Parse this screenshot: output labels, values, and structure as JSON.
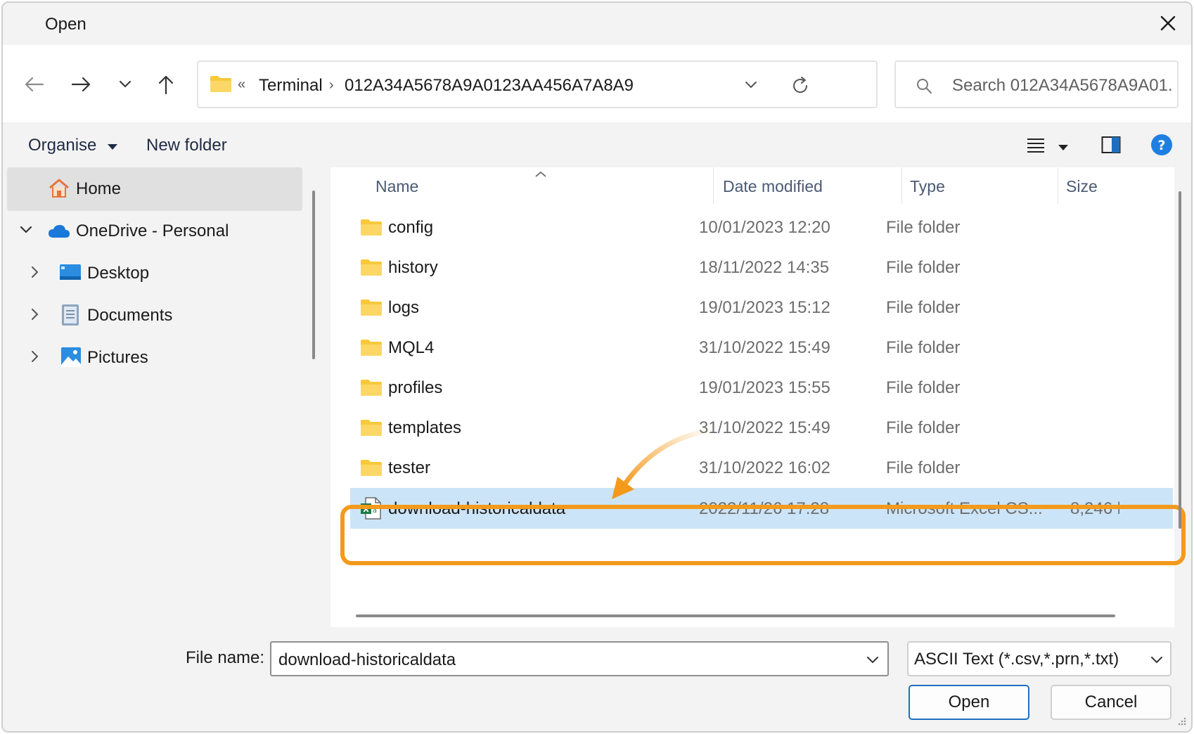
{
  "window": {
    "title": "Open"
  },
  "navigation": {
    "address_prefix": "«",
    "path": [
      "Terminal",
      "012A34A5678A9A0123AA456A7A8A9"
    ],
    "search_placeholder": "Search 012A34A5678A9A01..."
  },
  "toolbar": {
    "organise_label": "Organise",
    "new_folder_label": "New folder"
  },
  "sidebar": {
    "items": [
      {
        "label": "Home",
        "icon": "home-icon"
      },
      {
        "label": "OneDrive - Personal",
        "icon": "cloud-icon"
      },
      {
        "label": "Desktop",
        "icon": "desktop-icon"
      },
      {
        "label": "Documents",
        "icon": "documents-icon"
      },
      {
        "label": "Pictures",
        "icon": "pictures-icon"
      }
    ]
  },
  "files": {
    "columns": [
      "Name",
      "Date modified",
      "Type",
      "Size"
    ],
    "rows": [
      {
        "name": "config",
        "date": "10/01/2023 12:20",
        "type": "File folder",
        "size": ""
      },
      {
        "name": "history",
        "date": "18/11/2022 14:35",
        "type": "File folder",
        "size": ""
      },
      {
        "name": "logs",
        "date": "19/01/2023 15:12",
        "type": "File folder",
        "size": ""
      },
      {
        "name": "MQL4",
        "date": "31/10/2022 15:49",
        "type": "File folder",
        "size": ""
      },
      {
        "name": "profiles",
        "date": "19/01/2023 15:55",
        "type": "File folder",
        "size": ""
      },
      {
        "name": "templates",
        "date": "31/10/2022 15:49",
        "type": "File folder",
        "size": ""
      },
      {
        "name": "tester",
        "date": "31/10/2022 16:02",
        "type": "File folder",
        "size": ""
      },
      {
        "name": "download-historicaldata",
        "date": "2022/11/26 17:28",
        "type": "Microsoft Excel CS...",
        "size": "8,246 k"
      }
    ]
  },
  "footer": {
    "file_name_label": "File name:",
    "file_name_value": "download-historicaldata",
    "file_type_value": "ASCII Text (*.csv,*.prn,*.txt)",
    "open_label": "Open",
    "cancel_label": "Cancel"
  },
  "colors": {
    "highlight": "#f39a1c",
    "selection": "#cce4f7",
    "folder": "#f8c93c",
    "accent": "#1f6fbf"
  }
}
